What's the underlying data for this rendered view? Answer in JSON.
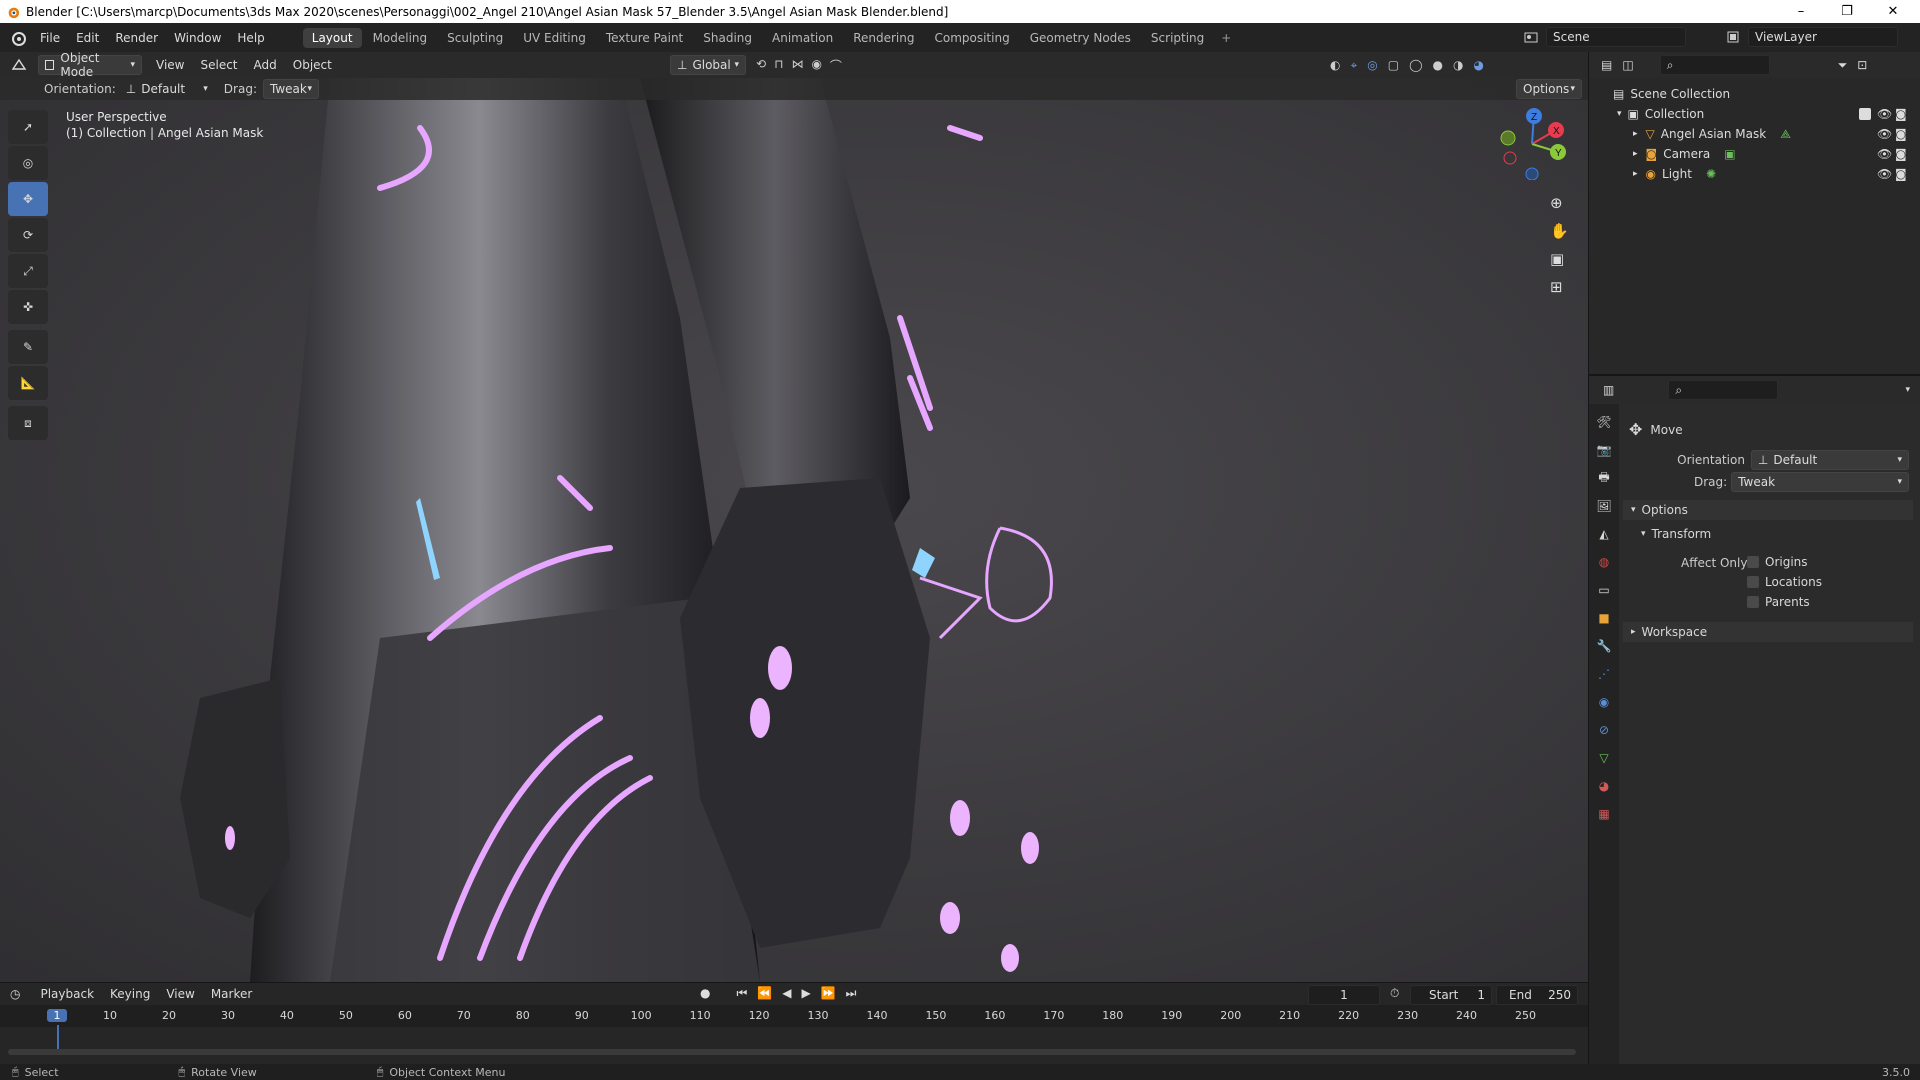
{
  "window": {
    "title": "Blender [C:\\Users\\marcp\\Documents\\3ds Max 2020\\scenes\\Personaggi\\002_Angel 210\\Angel Asian Mask 57_Blender 3.5\\Angel Asian Mask Blender.blend]",
    "minimize": "–",
    "restore": "❐",
    "close": "✕"
  },
  "menubar": {
    "items": [
      "File",
      "Edit",
      "Render",
      "Window",
      "Help"
    ],
    "workspaces": [
      "Layout",
      "Modeling",
      "Sculpting",
      "UV Editing",
      "Texture Paint",
      "Shading",
      "Animation",
      "Rendering",
      "Compositing",
      "Geometry Nodes",
      "Scripting"
    ],
    "add_workspace": "+",
    "scene": "Scene",
    "view_layer": "ViewLayer"
  },
  "viewport_header": {
    "mode": "Object Mode",
    "menus": [
      "View",
      "Select",
      "Add",
      "Object"
    ],
    "transform_orientation": "Global",
    "orientation_label": "Orientation:",
    "orientation_value": "Default",
    "drag_label": "Drag:",
    "drag_value": "Tweak",
    "options": "Options"
  },
  "viewport": {
    "perspective": "User Perspective",
    "collection_info": "(1) Collection | Angel Asian Mask",
    "gizmo_axes": [
      "X",
      "Y",
      "Z"
    ]
  },
  "outliner": {
    "root": "Scene Collection",
    "collection": "Collection",
    "items": [
      "Angel Asian Mask",
      "Camera",
      "Light"
    ]
  },
  "properties": {
    "tool_name": "Move",
    "orientation_label": "Orientation",
    "orientation_value": "Default",
    "drag_label": "Drag:",
    "drag_value": "Tweak",
    "options_panel": "Options",
    "transform_panel": "Transform",
    "affect_only_label": "Affect Only",
    "affect_options": [
      "Origins",
      "Locations",
      "Parents"
    ],
    "workspace_panel": "Workspace"
  },
  "timeline": {
    "menus": [
      "Playback",
      "Keying",
      "View",
      "Marker"
    ],
    "current_frame": "1",
    "start_label": "Start",
    "start_value": "1",
    "end_label": "End",
    "end_value": "250",
    "ruler": [
      "1",
      "10",
      "20",
      "30",
      "40",
      "50",
      "60",
      "70",
      "80",
      "90",
      "100",
      "110",
      "120",
      "130",
      "140",
      "150",
      "160",
      "170",
      "180",
      "190",
      "200",
      "210",
      "220",
      "230",
      "240",
      "250"
    ]
  },
  "statusbar": {
    "select": "Select",
    "rotate": "Rotate View",
    "context": "Object Context Menu",
    "version": "3.5.0"
  },
  "colors": {
    "accent": "#4772b3",
    "glow": "#e7a6ff",
    "active_frame": "#4772b3"
  }
}
